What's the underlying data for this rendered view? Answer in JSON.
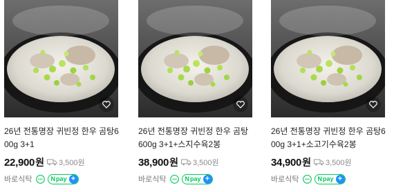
{
  "products": [
    {
      "title": "26년 전통명장 귀빈정 한우 곰탕600g 3+1",
      "price": "22,900",
      "currency": "원",
      "shipping": "3,500원",
      "seller": "바로식탁",
      "npay": "pay"
    },
    {
      "title": "26년 전통명장 귀빈정 한우 곰탕 600g 3+1+스지수육2봉",
      "price": "38,900",
      "currency": "원",
      "shipping": "3,500원",
      "seller": "바로식탁",
      "npay": "pay"
    },
    {
      "title": "26년 전통명장 귀빈정 한우 곰탕600g 3+1+소고기수육2봉",
      "price": "34,900",
      "currency": "원",
      "shipping": "3,500원",
      "seller": "바로식탁",
      "npay": "pay"
    }
  ],
  "icons": {
    "wish": "heart-icon",
    "shipping": "truck-icon",
    "talk": "talk-bubble-icon",
    "npay": "npay-plus-icon"
  },
  "colors": {
    "npay_green": "#03c75a",
    "plus_blue": "#1e90ff"
  }
}
